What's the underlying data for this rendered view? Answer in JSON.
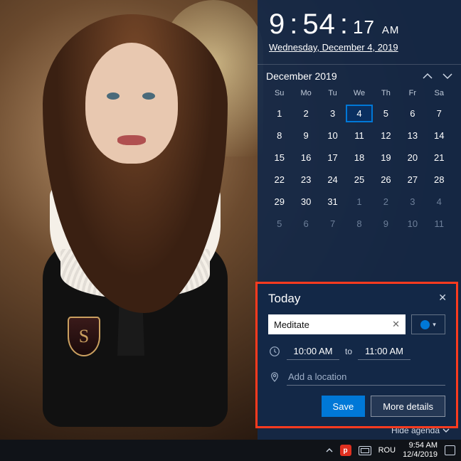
{
  "clock": {
    "h": "9",
    "m": "54",
    "s": "17",
    "ampm": "AM",
    "date": "Wednesday, December 4, 2019"
  },
  "calendar": {
    "title": "December 2019",
    "dow": [
      "Su",
      "Mo",
      "Tu",
      "We",
      "Th",
      "Fr",
      "Sa"
    ],
    "today": 4,
    "cells": [
      {
        "n": 1
      },
      {
        "n": 2
      },
      {
        "n": 3
      },
      {
        "n": 4,
        "today": true
      },
      {
        "n": 5
      },
      {
        "n": 6
      },
      {
        "n": 7
      },
      {
        "n": 8
      },
      {
        "n": 9
      },
      {
        "n": 10
      },
      {
        "n": 11
      },
      {
        "n": 12
      },
      {
        "n": 13
      },
      {
        "n": 14
      },
      {
        "n": 15
      },
      {
        "n": 16
      },
      {
        "n": 17
      },
      {
        "n": 18
      },
      {
        "n": 19
      },
      {
        "n": 20
      },
      {
        "n": 21
      },
      {
        "n": 22
      },
      {
        "n": 23
      },
      {
        "n": 24
      },
      {
        "n": 25
      },
      {
        "n": 26
      },
      {
        "n": 27
      },
      {
        "n": 28
      },
      {
        "n": 29
      },
      {
        "n": 30
      },
      {
        "n": 31
      },
      {
        "n": 1,
        "dim": true
      },
      {
        "n": 2,
        "dim": true
      },
      {
        "n": 3,
        "dim": true
      },
      {
        "n": 4,
        "dim": true
      },
      {
        "n": 5,
        "dim": true
      },
      {
        "n": 6,
        "dim": true
      },
      {
        "n": 7,
        "dim": true
      },
      {
        "n": 8,
        "dim": true
      },
      {
        "n": 9,
        "dim": true
      },
      {
        "n": 10,
        "dim": true
      },
      {
        "n": 11,
        "dim": true
      }
    ]
  },
  "agenda": {
    "heading": "Today",
    "event_name": "Meditate",
    "start": "10:00 AM",
    "to": "to",
    "end": "11:00 AM",
    "location_placeholder": "Add a location",
    "save": "Save",
    "more": "More details",
    "hide": "Hide agenda"
  },
  "taskbar": {
    "lang": "ROU",
    "tray_time": "9:54 AM",
    "tray_date": "12/4/2019"
  }
}
